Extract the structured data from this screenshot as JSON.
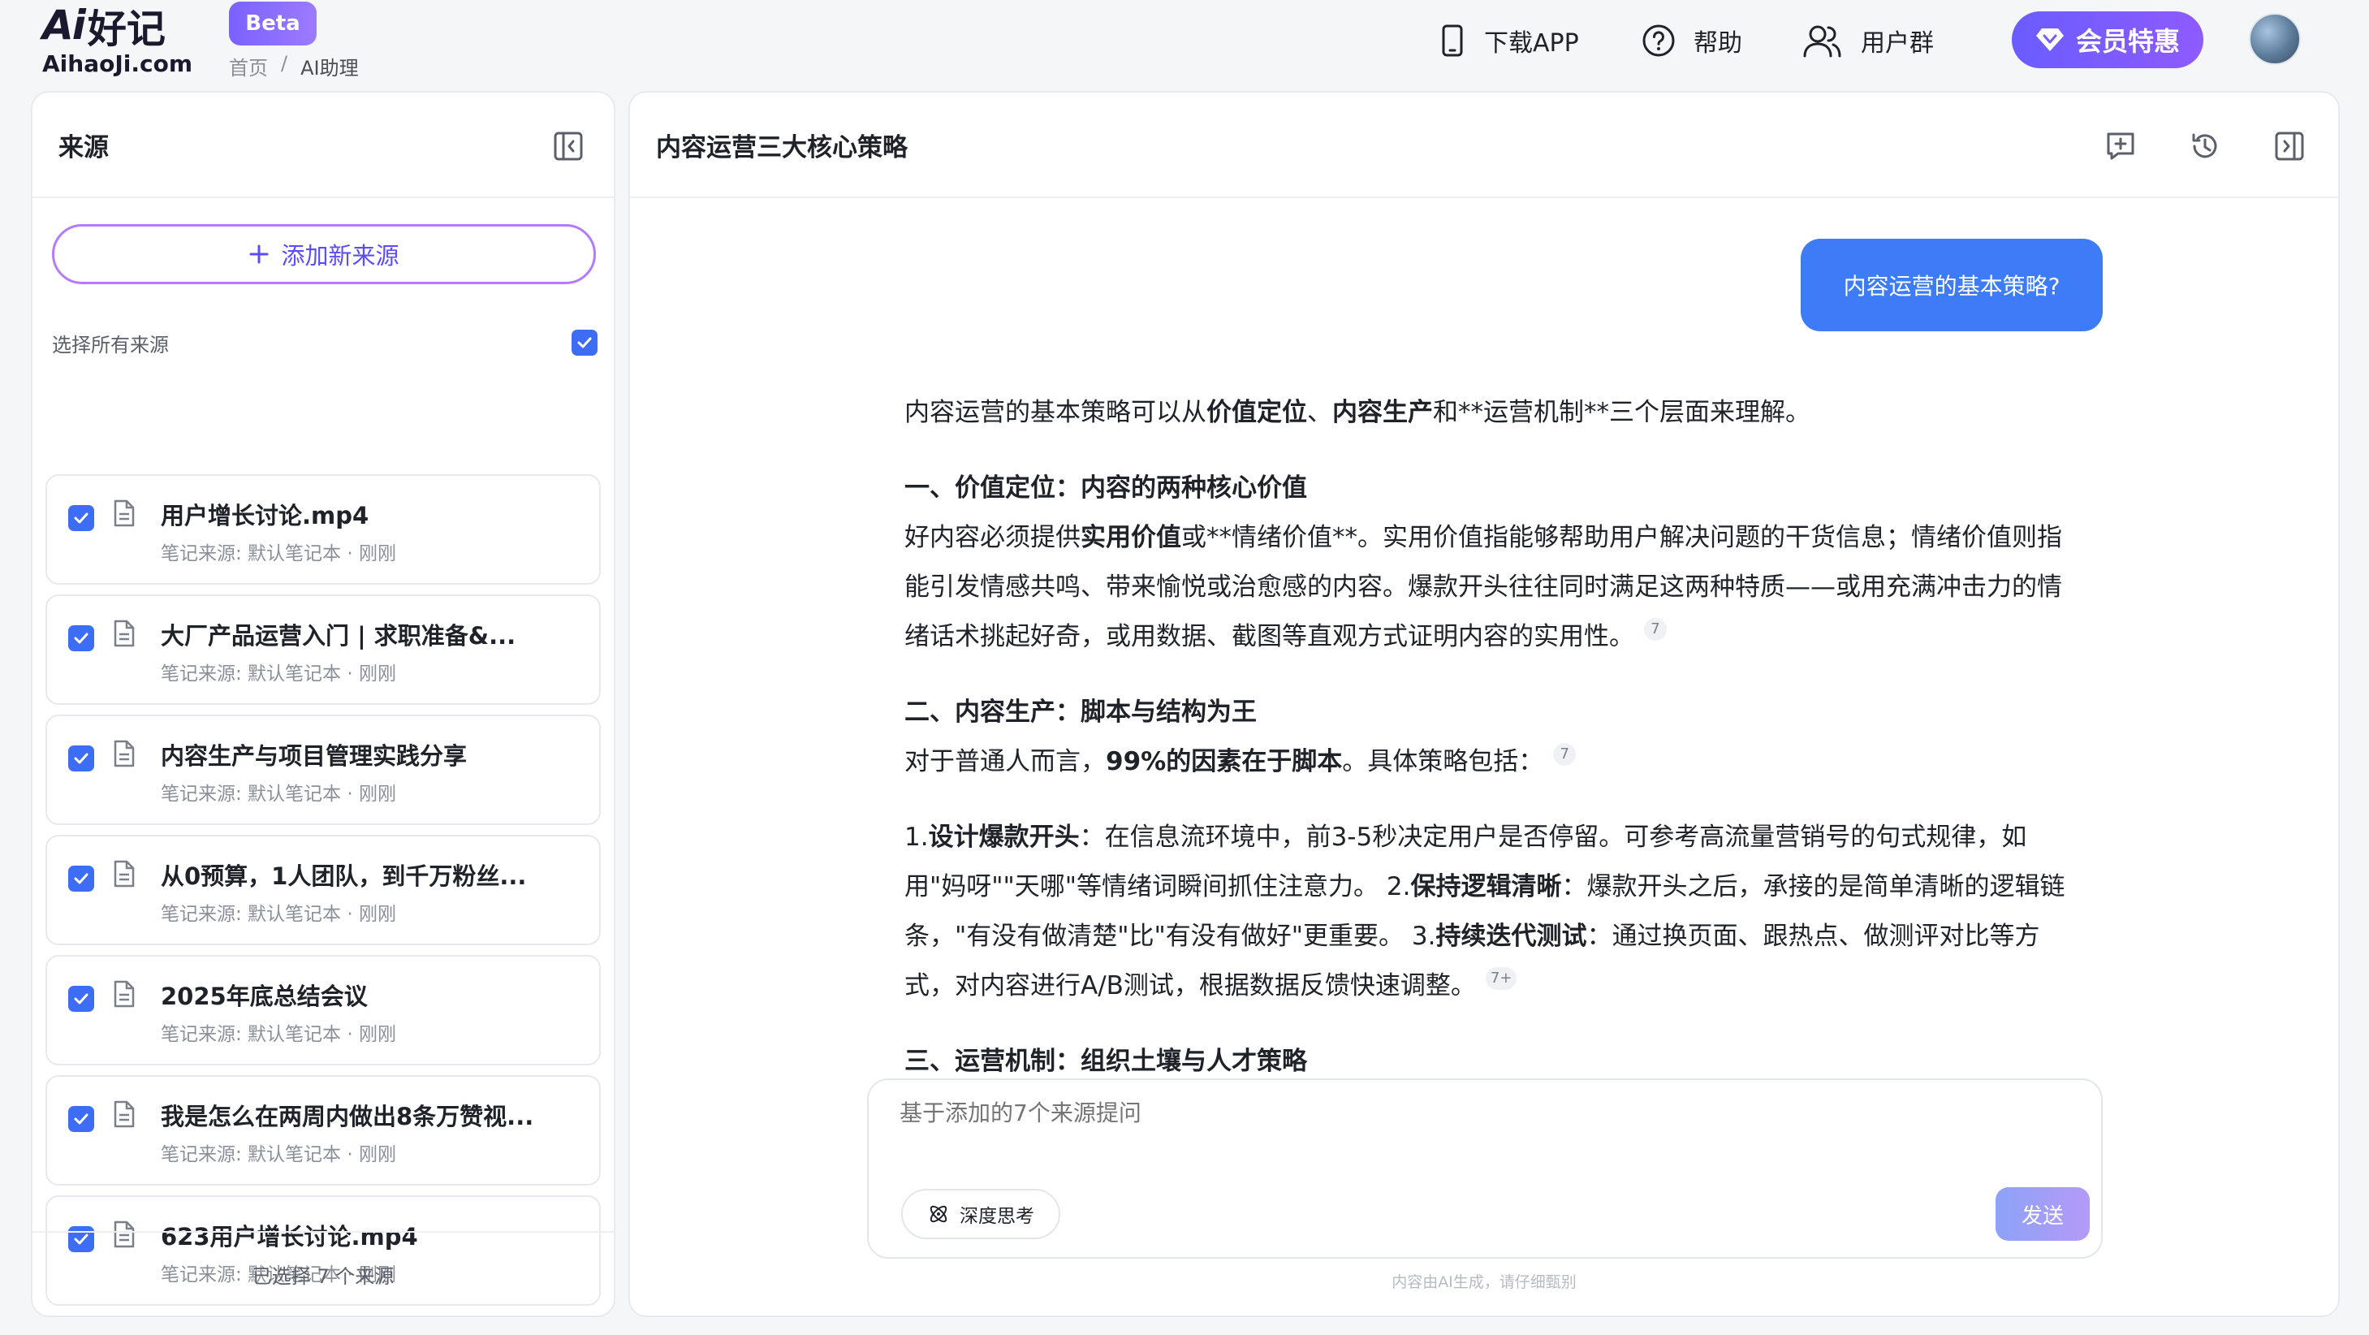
{
  "logo": {
    "ai": "Ai",
    "cn": "好记",
    "site": "AihaoJi.com"
  },
  "beta": "Beta",
  "breadcrumb": {
    "home": "首页",
    "sep": "/",
    "current": "AI助理"
  },
  "nav": {
    "download": "下载APP",
    "help": "帮助",
    "group": "用户群",
    "vip": "会员特惠"
  },
  "sources": {
    "title": "来源",
    "add_button": "添加新来源",
    "select_all": "选择所有来源",
    "items": [
      {
        "name": "用户增长讨论.mp4",
        "meta": "笔记来源: 默认笔记本 · 刚刚"
      },
      {
        "name": "大厂产品运营入门 | 求职准备&...",
        "meta": "笔记来源: 默认笔记本 · 刚刚"
      },
      {
        "name": "内容生产与项目管理实践分享",
        "meta": "笔记来源: 默认笔记本 · 刚刚"
      },
      {
        "name": "从0预算，1人团队，到千万粉丝...",
        "meta": "笔记来源: 默认笔记本 · 刚刚"
      },
      {
        "name": "2025年底总结会议",
        "meta": "笔记来源: 默认笔记本 · 刚刚"
      },
      {
        "name": "我是怎么在两周内做出8条万赞视...",
        "meta": "笔记来源: 默认笔记本 · 刚刚"
      },
      {
        "name": "623用户增长讨论.mp4",
        "meta": "笔记来源: 默认笔记本 · 刚刚"
      }
    ],
    "footer": "已选择 7 个来源"
  },
  "chat": {
    "title": "内容运营三大核心策略",
    "user_message": "内容运营的基本策略?",
    "answer": {
      "intro_a": "内容运营的基本策略可以从",
      "intro_b1": "价值定位",
      "intro_c": "、",
      "intro_b2": "内容生产",
      "intro_d": "和**运营机制**三个层面来理解。",
      "s1_title": "一、价值定位：内容的两种核心价值",
      "s1_a": "好内容必须提供",
      "s1_b": "实用价值",
      "s1_c": "或**情绪价值**。实用价值指能够帮助用户解决问题的干货信息；情绪价值则指能引发情感共鸣、带来愉悦或治愈感的内容。爆款开头往往同时满足这两种特质——或用充满冲击力的情绪话术挑起好奇，或用数据、截图等直观方式证明内容的实用性。",
      "s1_ref": "7",
      "s2_title": "二、内容生产：脚本与结构为王",
      "s2_a": "对于普通人而言，",
      "s2_b": "99%的因素在于脚本",
      "s2_c": "。具体策略包括：",
      "s2_ref": "7",
      "p1_num": "1.",
      "p1_title": "设计爆款开头",
      "p1_text": "：在信息流环境中，前3-5秒决定用户是否停留。可参考高流量营销号的句式规律，如用\"妈呀\"\"天哪\"等情绪词瞬间抓住注意力。",
      "p2_num": "2.",
      "p2_title": "保持逻辑清晰",
      "p2_text": "：爆款开头之后，承接的是简单清晰的逻辑链条，\"有没有做清楚\"比\"有没有做好\"更重要。",
      "p3_num": "3.",
      "p3_title": "持续迭代测试",
      "p3_text": "：通过换页面、跟热点、做测评对比等方式，对内容进行A/B测试，根据数据反馈快速调整。",
      "p_ref": "7+",
      "s3_title": "三、运营机制：组织土壤与人才策略"
    },
    "input_placeholder": "基于添加的7个来源提问",
    "deep_think": "深度思考",
    "send": "发送",
    "disclaimer": "内容由AI生成，请仔细甄别"
  },
  "colors": {
    "accent": "#3d7cf6",
    "checkbox": "#3d6cf5",
    "brand": "#7b61ff"
  }
}
